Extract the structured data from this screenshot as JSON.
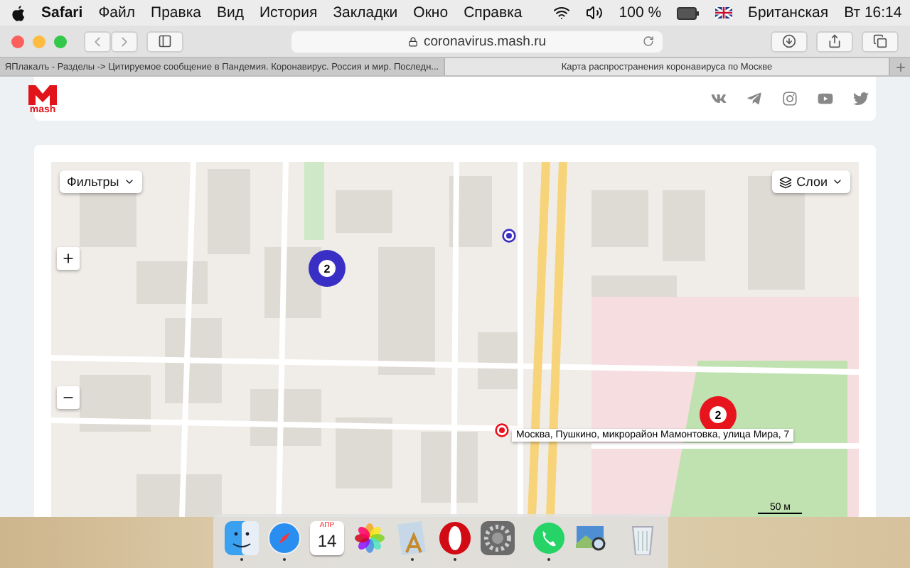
{
  "menu_bar": {
    "app": "Safari",
    "menus": [
      "Файл",
      "Правка",
      "Вид",
      "История",
      "Закладки",
      "Окно",
      "Справка"
    ],
    "battery": "100 %",
    "input_source": "Британская",
    "clock": "Вт 16:14"
  },
  "toolbar": {
    "address": "coronavirus.mash.ru"
  },
  "tabs": [
    {
      "title": "ЯПлакалъ - Разделы -> Цитируемое сообщение в Пандемия. Коронавирус. Россия и мир. Последн...",
      "selected": false
    },
    {
      "title": "Карта распространения коронавируса по Москве",
      "selected": true
    }
  ],
  "site": {
    "logo": "mash"
  },
  "map": {
    "filters_button": "Фильтры",
    "layers_button": "Слои",
    "clusters": [
      {
        "count": "2",
        "color": "#3a2fc4"
      },
      {
        "count": "2",
        "color": "#e8141d"
      }
    ],
    "tooltip": "Москва, Пушкино, микрорайон Мамонтовка, улица Мира, 7",
    "scale": "50 м"
  },
  "dock": {
    "calendar_month": "АПР",
    "calendar_day": "14",
    "apps": [
      {
        "kind": "finder",
        "running": true
      },
      {
        "kind": "safari",
        "running": true
      },
      {
        "kind": "calendar",
        "running": false
      },
      {
        "kind": "photos",
        "running": false
      },
      {
        "kind": "sketch",
        "running": true
      },
      {
        "kind": "opera",
        "running": true
      },
      {
        "kind": "settings",
        "running": false
      },
      {
        "kind": "whatsapp",
        "running": true
      },
      {
        "kind": "preview",
        "running": false
      },
      {
        "kind": "trash",
        "running": false
      }
    ]
  }
}
